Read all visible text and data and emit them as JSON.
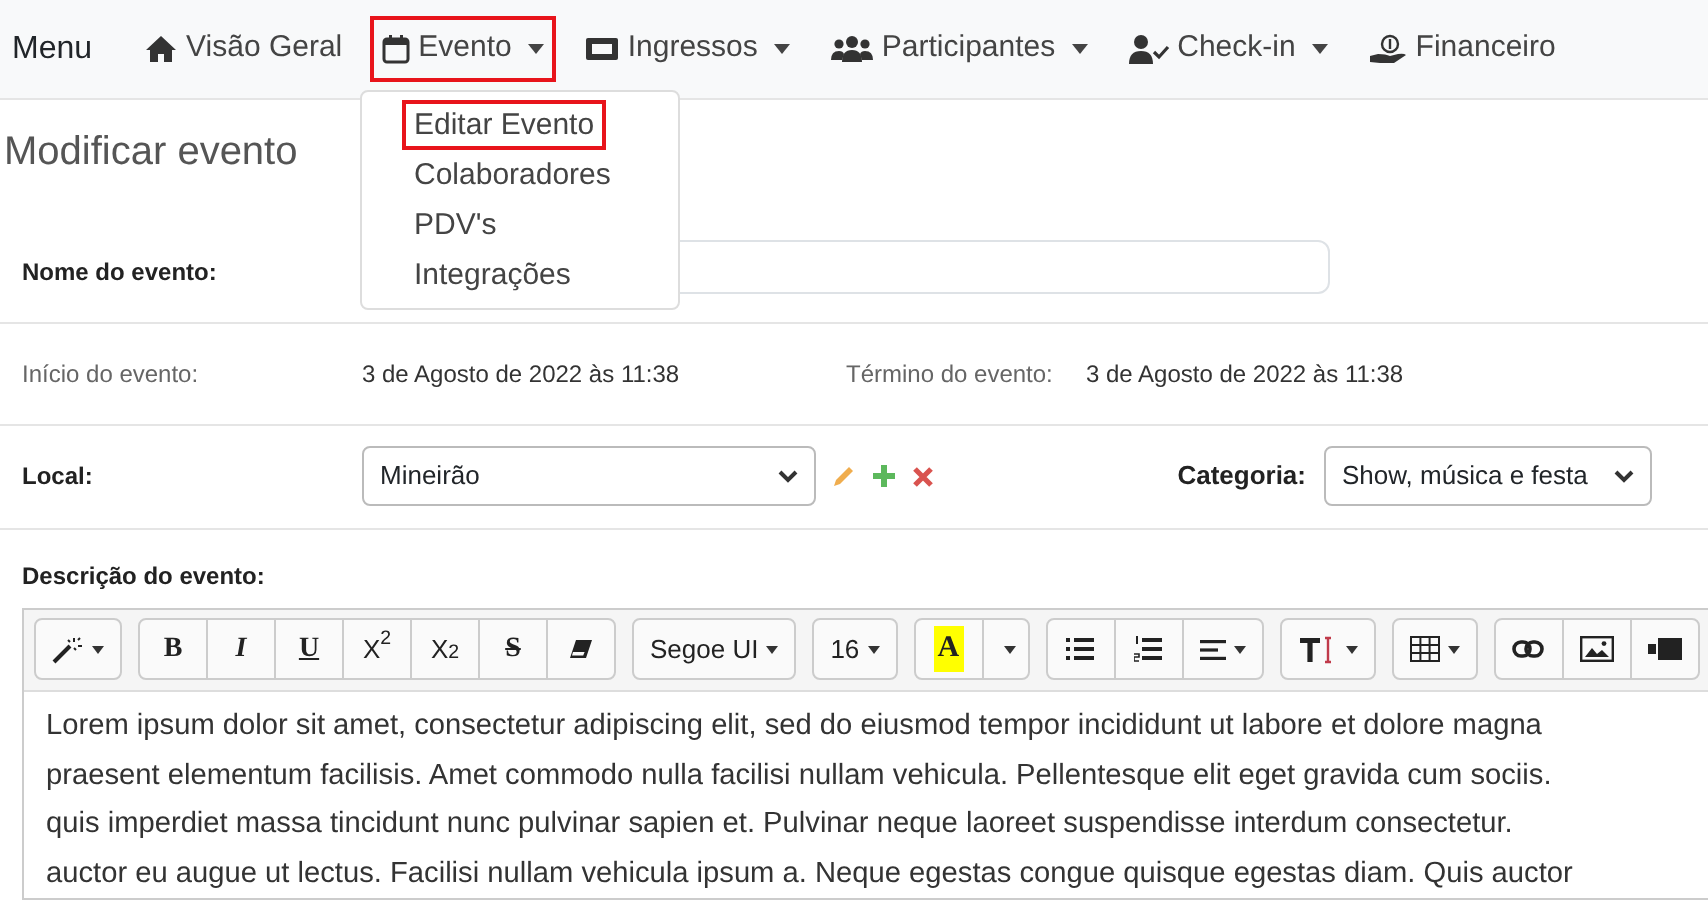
{
  "navbar": {
    "brand": "Menu",
    "items": [
      {
        "label": "Visão Geral",
        "dropdown": false,
        "selected": false
      },
      {
        "label": "Evento",
        "dropdown": true,
        "selected": true
      },
      {
        "label": "Ingressos",
        "dropdown": true,
        "selected": false
      },
      {
        "label": "Participantes",
        "dropdown": true,
        "selected": false
      },
      {
        "label": "Check-in",
        "dropdown": true,
        "selected": false
      },
      {
        "label": "Financeiro",
        "dropdown": false,
        "selected": false
      }
    ]
  },
  "dropdown_menu": {
    "items": [
      {
        "label": "Editar Evento",
        "selected": true
      },
      {
        "label": "Colaboradores",
        "selected": false
      },
      {
        "label": "PDV's",
        "selected": false
      },
      {
        "label": "Integrações",
        "selected": false
      }
    ]
  },
  "page_title": "Modificar evento",
  "event_name": {
    "label": "Nome do evento:"
  },
  "start": {
    "label": "Início do evento:",
    "value": "3 de Agosto de 2022 às 11:38"
  },
  "end": {
    "label": "Término do evento:",
    "value": "3 de Agosto de 2022 às 11:38"
  },
  "location": {
    "label": "Local:",
    "value": "Mineirão"
  },
  "category": {
    "label": "Categoria:",
    "value": "Show, música e festa"
  },
  "description": {
    "label": "Descrição do evento:",
    "toolbar": [
      [
        {
          "kind": "magic",
          "dropdown": true
        }
      ],
      [
        {
          "kind": "bold",
          "label": "B"
        },
        {
          "kind": "italic",
          "label": "I"
        },
        {
          "kind": "underline",
          "label": "U"
        },
        {
          "kind": "plain",
          "label": "X$^{2}$"
        },
        {
          "kind": "plain",
          "label": "X$_{2}$"
        },
        {
          "kind": "strike",
          "label": "S"
        },
        {
          "kind": "eraser"
        }
      ],
      [
        {
          "kind": "plain",
          "label": "Segoe UI",
          "dropdown": true
        }
      ],
      [
        {
          "kind": "plain",
          "label": "16",
          "dropdown": true
        }
      ],
      [
        {
          "kind": "color",
          "label": "A"
        },
        {
          "kind": "caret"
        }
      ],
      [
        {
          "kind": "ul"
        },
        {
          "kind": "ol"
        },
        {
          "kind": "align",
          "dropdown": true
        }
      ],
      [
        {
          "kind": "textheight",
          "dropdown": true
        }
      ],
      [
        {
          "kind": "table",
          "dropdown": true
        }
      ],
      [
        {
          "kind": "link"
        },
        {
          "kind": "image"
        },
        {
          "kind": "video"
        }
      ]
    ],
    "lines": [
      "Lorem ipsum dolor sit amet, consectetur adipiscing elit, sed do eiusmod tempor incididunt ut labore et dolore magna",
      "praesent elementum facilisis. Amet commodo nulla facilisi nullam vehicula. Pellentesque elit eget gravida cum sociis.",
      "quis imperdiet massa tincidunt nunc pulvinar sapien et. Pulvinar neque laoreet suspendisse interdum consectetur.",
      "auctor eu augue ut lectus. Facilisi nullam vehicula ipsum a. Neque egestas congue quisque egestas diam. Quis auctor"
    ]
  }
}
